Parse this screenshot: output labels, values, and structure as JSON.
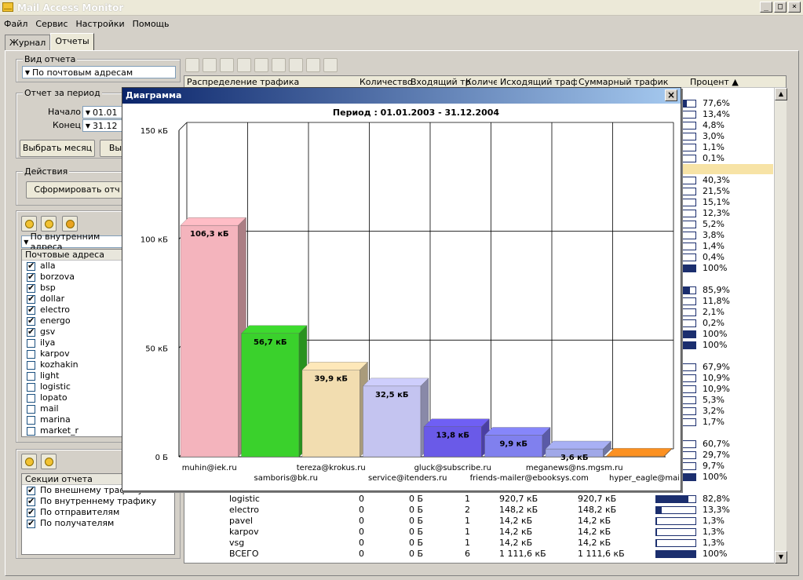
{
  "app": {
    "title": "Mail Access Monitor"
  },
  "window_buttons": [
    "_",
    "□",
    "×"
  ],
  "menu": [
    "Файл",
    "Сервис",
    "Настройки",
    "Помощь"
  ],
  "tabs": [
    "Журнал",
    "Отчеты"
  ],
  "left": {
    "report_type_label": "Вид отчета",
    "report_type_value": "По почтовым адресам",
    "period_label": "Отчет за период",
    "start_label": "Начало",
    "start_value": "01.01",
    "end_label": "Конец",
    "end_value": "31.12",
    "select_month": "Выбрать месяц",
    "select_other": "Вы",
    "actions_label": "Действия",
    "form_report": "Сформировать отч",
    "traffic_combo": "По внутренним адреса",
    "addresses_header": "Почтовые адреса",
    "addresses": [
      {
        "name": "alla",
        "checked": true
      },
      {
        "name": "borzova",
        "checked": true
      },
      {
        "name": "bsp",
        "checked": true
      },
      {
        "name": "dollar",
        "checked": true
      },
      {
        "name": "electro",
        "checked": true
      },
      {
        "name": "energo",
        "checked": true
      },
      {
        "name": "gsv",
        "checked": true
      },
      {
        "name": "ilya",
        "checked": false
      },
      {
        "name": "karpov",
        "checked": false
      },
      {
        "name": "kozhakin",
        "checked": false
      },
      {
        "name": "light",
        "checked": false
      },
      {
        "name": "logistic",
        "checked": false
      },
      {
        "name": "lopato",
        "checked": false
      },
      {
        "name": "mail",
        "checked": false
      },
      {
        "name": "marina",
        "checked": false
      },
      {
        "name": "market_r",
        "checked": false
      }
    ],
    "sections_header": "Секции отчета",
    "sections": [
      {
        "name": "По внешнему трафику",
        "checked": true
      },
      {
        "name": "По внутреннему трафику",
        "checked": true
      },
      {
        "name": "По отправителям",
        "checked": true
      },
      {
        "name": "По получателям",
        "checked": true
      }
    ]
  },
  "table": {
    "headers": [
      "Распределение трафика",
      "Количество",
      "Входящий тр",
      "Количес",
      "Исходящий трафик",
      "Суммарный трафик",
      "Процент ▲"
    ],
    "percents": [
      {
        "text": "77,6%",
        "fill": 0.776
      },
      {
        "text": "13,4%",
        "fill": 0.134
      },
      {
        "text": "4,8%",
        "fill": 0.048
      },
      {
        "text": "3,0%",
        "fill": 0.03
      },
      {
        "text": "1,1%",
        "fill": 0.011
      },
      {
        "text": "0,1%",
        "fill": 0.001
      },
      {
        "text": "",
        "fill": 0
      },
      {
        "text": "40,3%",
        "fill": 0.403
      },
      {
        "text": "21,5%",
        "fill": 0.215
      },
      {
        "text": "15,1%",
        "fill": 0.151
      },
      {
        "text": "12,3%",
        "fill": 0.123
      },
      {
        "text": "5,2%",
        "fill": 0.052
      },
      {
        "text": "3,8%",
        "fill": 0.038
      },
      {
        "text": "1,4%",
        "fill": 0.014
      },
      {
        "text": "0,4%",
        "fill": 0.004
      },
      {
        "text": "100%",
        "fill": 1.0
      },
      {
        "text": "",
        "fill": 0
      },
      {
        "text": "85,9%",
        "fill": 0.859
      },
      {
        "text": "11,8%",
        "fill": 0.118
      },
      {
        "text": "2,1%",
        "fill": 0.021
      },
      {
        "text": "0,2%",
        "fill": 0.002
      },
      {
        "text": "100%",
        "fill": 1.0
      },
      {
        "text": "100%",
        "fill": 1.0
      },
      {
        "text": "",
        "fill": 0
      },
      {
        "text": "67,9%",
        "fill": 0.679
      },
      {
        "text": "10,9%",
        "fill": 0.109
      },
      {
        "text": "10,9%",
        "fill": 0.109
      },
      {
        "text": "5,3%",
        "fill": 0.053
      },
      {
        "text": "3,2%",
        "fill": 0.032
      },
      {
        "text": "1,7%",
        "fill": 0.017
      },
      {
        "text": "",
        "fill": 0
      },
      {
        "text": "60,7%",
        "fill": 0.607
      },
      {
        "text": "29,7%",
        "fill": 0.297
      },
      {
        "text": "9,7%",
        "fill": 0.097
      },
      {
        "text": "100%",
        "fill": 1.0
      }
    ],
    "bottom_rows": [
      {
        "name": "logistic",
        "count": "0",
        "in": "0 Б",
        "n": "1",
        "out": "920,7 кБ",
        "sum": "920,7 кБ",
        "pct": "82,8%",
        "fill": 0.828
      },
      {
        "name": "electro",
        "count": "0",
        "in": "0 Б",
        "n": "2",
        "out": "148,2 кБ",
        "sum": "148,2 кБ",
        "pct": "13,3%",
        "fill": 0.133
      },
      {
        "name": "pavel",
        "count": "0",
        "in": "0 Б",
        "n": "1",
        "out": "14,2 кБ",
        "sum": "14,2 кБ",
        "pct": "1,3%",
        "fill": 0.013
      },
      {
        "name": "karpov",
        "count": "0",
        "in": "0 Б",
        "n": "1",
        "out": "14,2 кБ",
        "sum": "14,2 кБ",
        "pct": "1,3%",
        "fill": 0.013
      },
      {
        "name": "vsg",
        "count": "0",
        "in": "0 Б",
        "n": "1",
        "out": "14,2 кБ",
        "sum": "14,2 кБ",
        "pct": "1,3%",
        "fill": 0.013
      },
      {
        "name": "ВСЕГО",
        "count": "0",
        "in": "0 Б",
        "n": "6",
        "out": "1 111,6 кБ",
        "sum": "1 111,6 кБ",
        "pct": "100%",
        "fill": 1.0
      }
    ]
  },
  "dialog": {
    "title": "Диаграмма",
    "close": "×"
  },
  "chart_data": {
    "type": "bar",
    "title": "Период :   01.01.2003  -  31.12.2004",
    "ylim": [
      0,
      150
    ],
    "yticks": [
      "0 Б",
      "50 кБ",
      "100 кБ",
      "150 кБ"
    ],
    "categories": [
      "muhin@iek.ru",
      "samboris@bk.ru",
      "tereza@krokus.ru",
      "service@itenders.ru",
      "gluck@subscribe.ru",
      "friends-mailer@ebooksys.com",
      "meganews@ns.mgsm.ru",
      "hyper_eagle@mail.ru"
    ],
    "values": [
      106.3,
      56.7,
      39.9,
      32.5,
      13.8,
      9.9,
      3.6,
      0.3
    ],
    "labels": [
      "106,3 кБ",
      "56,7 кБ",
      "39,9 кБ",
      "32,5 кБ",
      "13,8 кБ",
      "9,9 кБ",
      "3,6 кБ",
      ""
    ],
    "colors": [
      "#f4b4bd",
      "#3ad12c",
      "#f2ddb0",
      "#c4c4f0",
      "#6a5ae8",
      "#8080ee",
      "#a0a8e8",
      "#f08a20"
    ],
    "grid": true
  }
}
